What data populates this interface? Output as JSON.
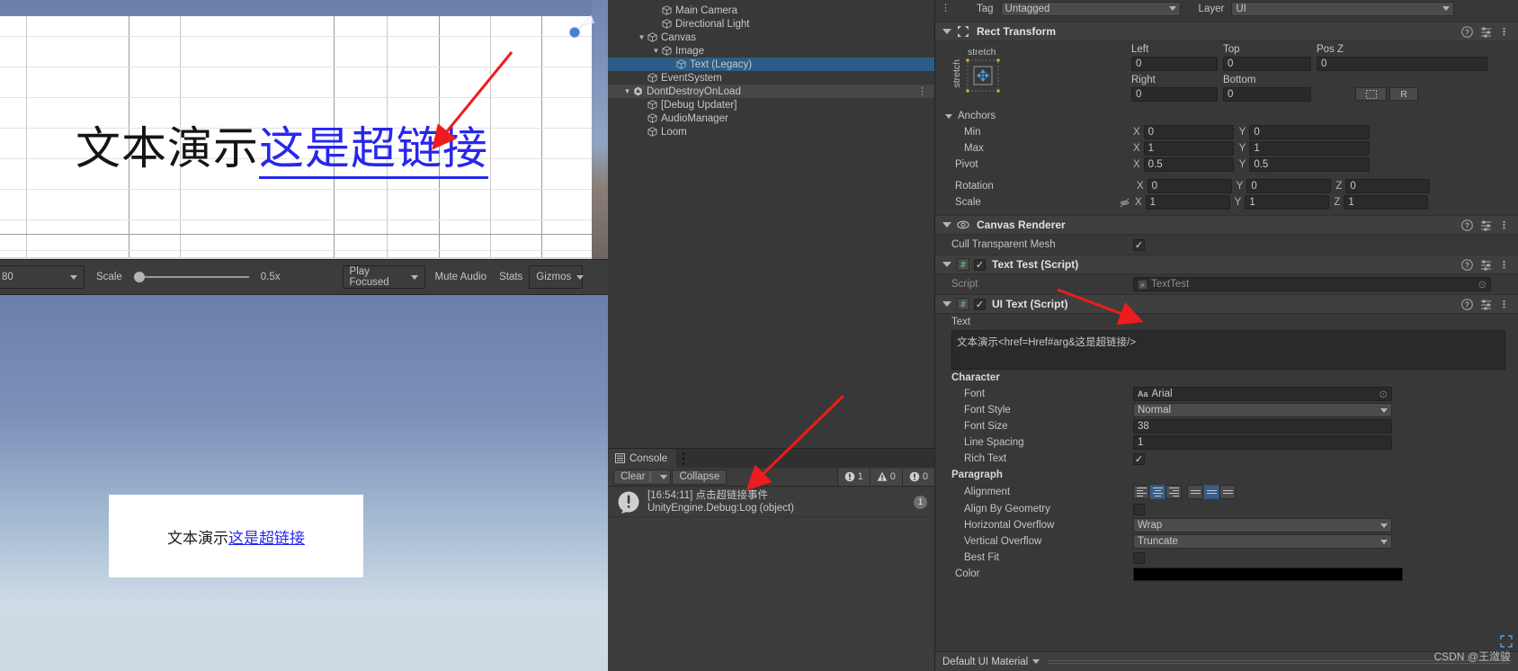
{
  "scene": {
    "text_plain": "文本演示",
    "text_link": "这是超链接"
  },
  "game_toolbar": {
    "resolution": "80",
    "scale_label": "Scale",
    "scale_value": "0.5x",
    "play_focused": "Play Focused",
    "mute_audio": "Mute Audio",
    "stats": "Stats",
    "gizmos": "Gizmos",
    "kebab": "⋮"
  },
  "game_view": {
    "text_plain": "文本演示",
    "text_link": "这是超链接"
  },
  "hierarchy": {
    "items": [
      {
        "label": "Main Camera",
        "indent": 3,
        "icon": "cube-icon",
        "fold": "",
        "state": "normal"
      },
      {
        "label": "Directional Light",
        "indent": 3,
        "icon": "cube-icon",
        "fold": "",
        "state": "normal"
      },
      {
        "label": "Canvas",
        "indent": 2,
        "icon": "cube-icon",
        "fold": "▼",
        "state": "normal"
      },
      {
        "label": "Image",
        "indent": 3,
        "icon": "cube-icon",
        "fold": "▼",
        "state": "normal"
      },
      {
        "label": "Text (Legacy)",
        "indent": 4,
        "icon": "cube-icon",
        "fold": "",
        "state": "selected"
      },
      {
        "label": "EventSystem",
        "indent": 2,
        "icon": "cube-icon",
        "fold": "",
        "state": "normal"
      },
      {
        "label": "DontDestroyOnLoad",
        "indent": 1,
        "icon": "unity-icon",
        "fold": "▼",
        "state": "ddol"
      },
      {
        "label": "[Debug Updater]",
        "indent": 2,
        "icon": "cube-icon",
        "fold": "",
        "state": "normal"
      },
      {
        "label": "AudioManager",
        "indent": 2,
        "icon": "cube-icon",
        "fold": "",
        "state": "normal"
      },
      {
        "label": "Loom",
        "indent": 2,
        "icon": "cube-icon",
        "fold": "",
        "state": "normal"
      }
    ]
  },
  "console": {
    "tab_label": "Console",
    "clear_label": "Clear",
    "collapse_label": "Collapse",
    "counts": {
      "error": "1",
      "warning": "0",
      "info": "0"
    },
    "entry": {
      "line1": "[16:54:11] 点击超链接事件",
      "line2": "UnityEngine.Debug:Log (object)",
      "count": "1"
    }
  },
  "inspector": {
    "tag_label": "Tag",
    "tag_value": "Untagged",
    "layer_label": "Layer",
    "layer_value": "UI",
    "rect_transform": {
      "title": "Rect Transform",
      "anchor_preset_h": "stretch",
      "anchor_preset_v": "stretch",
      "left_label": "Left",
      "left_value": "0",
      "top_label": "Top",
      "top_value": "0",
      "posz_label": "Pos Z",
      "posz_value": "0",
      "right_label": "Right",
      "right_value": "0",
      "bottom_label": "Bottom",
      "bottom_value": "0",
      "blueprint_label": "R",
      "anchors_label": "Anchors",
      "min_label": "Min",
      "min_x": "0",
      "min_y": "0",
      "max_label": "Max",
      "max_x": "1",
      "max_y": "1",
      "pivot_label": "Pivot",
      "pivot_x": "0.5",
      "pivot_y": "0.5",
      "rotation_label": "Rotation",
      "rot_x": "0",
      "rot_y": "0",
      "rot_z": "0",
      "scale_label": "Scale",
      "scale_x": "1",
      "scale_y": "1",
      "scale_z": "1"
    },
    "canvas_renderer": {
      "title": "Canvas Renderer",
      "cull_label": "Cull Transparent Mesh",
      "cull_checked": "✓"
    },
    "text_test": {
      "title": "Text Test (Script)",
      "script_label": "Script",
      "script_value": "TextTest",
      "enabled": "✓"
    },
    "ui_text": {
      "title": "UI Text (Script)",
      "enabled": "✓",
      "text_label": "Text",
      "text_value": "文本演示<href=Href#arg&这是超链接/>",
      "character_label": "Character",
      "font_label": "Font",
      "font_value": "Arial",
      "font_style_label": "Font Style",
      "font_style_value": "Normal",
      "font_size_label": "Font Size",
      "font_size_value": "38",
      "line_spacing_label": "Line Spacing",
      "line_spacing_value": "1",
      "rich_text_label": "Rich Text",
      "rich_text_checked": "✓",
      "paragraph_label": "Paragraph",
      "alignment_label": "Alignment",
      "align_h_selected": 1,
      "align_v_selected": 1,
      "align_by_geometry_label": "Align By Geometry",
      "horizontal_overflow_label": "Horizontal Overflow",
      "horizontal_overflow_value": "Wrap",
      "vertical_overflow_label": "Vertical Overflow",
      "vertical_overflow_value": "Truncate",
      "best_fit_label": "Best Fit",
      "color_label": "Color",
      "color_value": "#000000"
    },
    "footer_material": "Default UI Material"
  },
  "watermark": "CSDN @王潋骏",
  "accents": {
    "selection_blue": "#2c5d87",
    "arrow_red": "#ee1c1c",
    "link_blue": "#2727ee",
    "toggle_blue": "#3b5e85"
  }
}
